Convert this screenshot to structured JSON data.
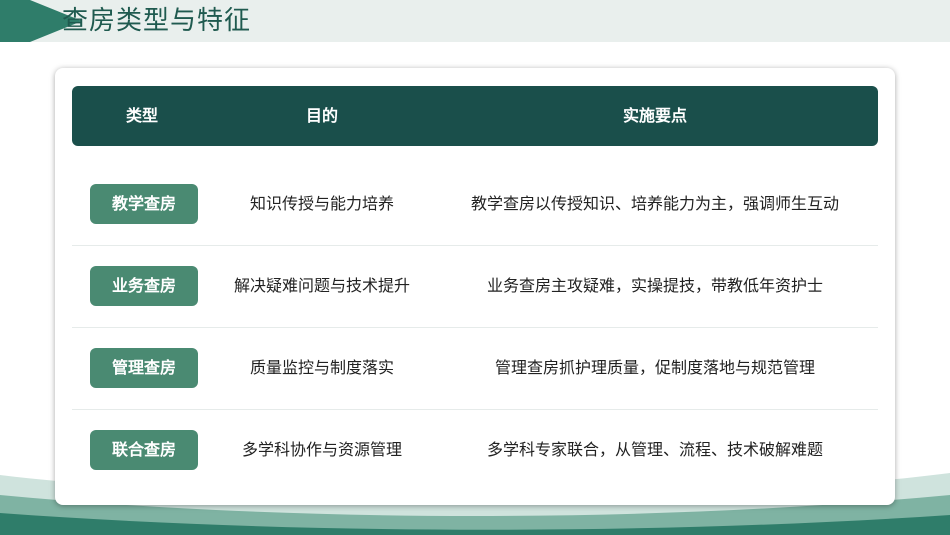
{
  "header": {
    "title": "查房类型与特征"
  },
  "table": {
    "columns": {
      "type": "类型",
      "purpose": "目的",
      "key_points": "实施要点"
    },
    "rows": [
      {
        "type": "教学查房",
        "purpose": "知识传授与能力培养",
        "key_points": "教学查房以传授知识、培养能力为主，强调师生互动"
      },
      {
        "type": "业务查房",
        "purpose": "解决疑难问题与技术提升",
        "key_points": "业务查房主攻疑难，实操提技，带教低年资护士"
      },
      {
        "type": "管理查房",
        "purpose": "质量监控与制度落实",
        "key_points": "管理查房抓护理质量，促制度落地与规范管理"
      },
      {
        "type": "联合查房",
        "purpose": "多学科协作与资源管理",
        "key_points": "多学科专家联合，从管理、流程、技术破解难题"
      }
    ]
  },
  "colors": {
    "header_band": "#e9efed",
    "accent": "#2f7d6a",
    "table_header": "#1a4f4b",
    "badge": "#4a8a72",
    "title_text": "#1f5a4f"
  }
}
